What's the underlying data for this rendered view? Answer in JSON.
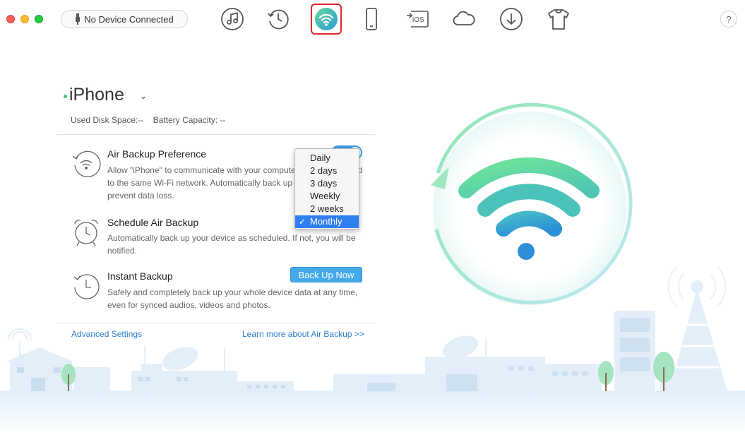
{
  "toolbar": {
    "device_status": "No Device Connected",
    "tools": [
      {
        "name": "music-icon"
      },
      {
        "name": "history-icon"
      },
      {
        "name": "air-backup-icon"
      },
      {
        "name": "phone-icon"
      },
      {
        "name": "to-ios-icon",
        "label": "iOS"
      },
      {
        "name": "cloud-icon"
      },
      {
        "name": "download-icon"
      },
      {
        "name": "tshirt-icon"
      }
    ],
    "help_label": "?"
  },
  "device": {
    "name": "iPhone",
    "used_disk_space": "Used Disk Space:--",
    "battery_capacity": "Battery Capacity: --"
  },
  "options": {
    "air_backup": {
      "title": "Air Backup Preference",
      "description": "Allow \"iPhone\" to communicate with your computer when connected to the same Wi-Fi network. Automatically back up your iOS data to prevent data loss.",
      "enabled": true
    },
    "schedule": {
      "title": "Schedule Air Backup",
      "description": "Automatically back up your device as scheduled. If not, you will be notified."
    },
    "instant": {
      "title": "Instant Backup",
      "description": "Safely and completely back up your whole device data at any time, even for synced audios, videos and photos.",
      "button": "Back Up Now"
    }
  },
  "dropdown": {
    "items": [
      "Daily",
      "2 days",
      "3 days",
      "Weekly",
      "2 weeks",
      "Monthly"
    ],
    "selected": "Monthly",
    "check": "✓"
  },
  "links": {
    "advanced": "Advanced Settings",
    "learn_more": "Learn more about Air Backup >>"
  },
  "colors": {
    "accent": "#3e9de8",
    "link": "#2b7fcf",
    "selection": "#2f7ff3",
    "wifi_green": "#6bdc8f",
    "wifi_blue": "#2a8bd8"
  }
}
